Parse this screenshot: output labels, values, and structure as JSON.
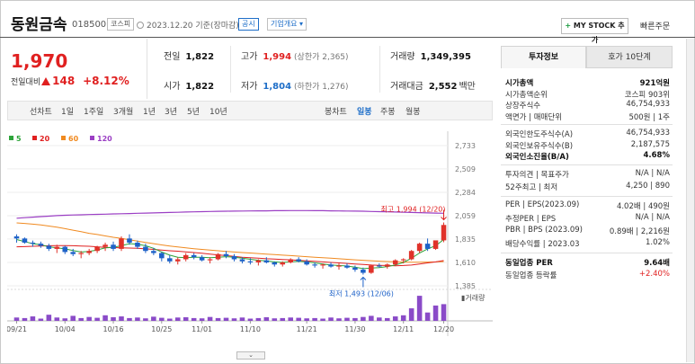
{
  "header": {
    "name": "동원금속",
    "code": "018500",
    "market": "코스피",
    "date": "2023.12.20 기준(장마감)",
    "disclosure": "공시",
    "company_info": "기업개요",
    "mystock": "MY STOCK 추가",
    "quick_order": "빠른주문"
  },
  "price": {
    "current": "1,970",
    "diff_label": "전일대비",
    "diff": "148",
    "pct": "+8.12%"
  },
  "stats": {
    "prev_label": "전일",
    "prev": "1,822",
    "high_label": "고가",
    "high": "1,994",
    "high_limit": "(상한가 2,365)",
    "volume_label": "거래량",
    "volume": "1,349,395",
    "open_label": "시가",
    "open": "1,822",
    "low_label": "저가",
    "low": "1,804",
    "low_limit": "(하한가 1,276)",
    "amount_label": "거래대금",
    "amount": "2,552",
    "amount_unit": "백만"
  },
  "tabs": {
    "left": [
      "선차트",
      "1일",
      "1주일",
      "3개월",
      "1년",
      "3년",
      "5년",
      "10년"
    ],
    "right": [
      "봉차트",
      "일봉",
      "주봉",
      "월봉"
    ]
  },
  "legend": [
    {
      "label": "5",
      "color": "#2da43a"
    },
    {
      "label": "20",
      "color": "#e02020"
    },
    {
      "label": "60",
      "color": "#f08a20"
    },
    {
      "label": "120",
      "color": "#9b3fc4"
    }
  ],
  "chart_data": {
    "type": "candlestick",
    "y_ticks": [
      "2,733",
      "2,509",
      "2,284",
      "2,059",
      "1,835",
      "1,610",
      "1,385"
    ],
    "ylim": [
      1385,
      2733
    ],
    "x_ticks": [
      "09/21",
      "10/04",
      "10/16",
      "10/25",
      "11/01",
      "11/10",
      "11/21",
      "11/30",
      "12/11",
      "12/20"
    ],
    "volume_label": "거래량",
    "max_annotation": "최고 1,994 (12/20)",
    "min_annotation": "최저 1,493 (12/06)",
    "candles": [
      [
        1860,
        1880,
        1800,
        1840
      ],
      [
        1840,
        1850,
        1790,
        1800
      ],
      [
        1800,
        1820,
        1760,
        1790
      ],
      [
        1790,
        1810,
        1750,
        1770
      ],
      [
        1770,
        1790,
        1720,
        1740
      ],
      [
        1740,
        1780,
        1700,
        1760
      ],
      [
        1760,
        1770,
        1690,
        1710
      ],
      [
        1710,
        1740,
        1670,
        1690
      ],
      [
        1690,
        1720,
        1650,
        1700
      ],
      [
        1700,
        1740,
        1680,
        1720
      ],
      [
        1720,
        1770,
        1700,
        1760
      ],
      [
        1760,
        1800,
        1720,
        1780
      ],
      [
        1780,
        1810,
        1720,
        1740
      ],
      [
        1740,
        1860,
        1720,
        1840
      ],
      [
        1840,
        1880,
        1780,
        1800
      ],
      [
        1800,
        1820,
        1740,
        1760
      ],
      [
        1760,
        1790,
        1700,
        1720
      ],
      [
        1720,
        1750,
        1680,
        1700
      ],
      [
        1700,
        1710,
        1620,
        1650
      ],
      [
        1650,
        1680,
        1600,
        1620
      ],
      [
        1620,
        1660,
        1590,
        1640
      ],
      [
        1640,
        1700,
        1620,
        1680
      ],
      [
        1680,
        1700,
        1640,
        1660
      ],
      [
        1660,
        1680,
        1620,
        1630
      ],
      [
        1630,
        1660,
        1600,
        1640
      ],
      [
        1640,
        1700,
        1630,
        1690
      ],
      [
        1690,
        1720,
        1650,
        1670
      ],
      [
        1670,
        1690,
        1620,
        1640
      ],
      [
        1640,
        1660,
        1600,
        1620
      ],
      [
        1620,
        1650,
        1590,
        1610
      ],
      [
        1610,
        1640,
        1580,
        1630
      ],
      [
        1630,
        1660,
        1600,
        1610
      ],
      [
        1610,
        1620,
        1570,
        1590
      ],
      [
        1590,
        1620,
        1570,
        1610
      ],
      [
        1610,
        1650,
        1600,
        1640
      ],
      [
        1640,
        1660,
        1610,
        1620
      ],
      [
        1620,
        1640,
        1580,
        1590
      ],
      [
        1590,
        1610,
        1560,
        1580
      ],
      [
        1580,
        1600,
        1550,
        1590
      ],
      [
        1590,
        1610,
        1560,
        1570
      ],
      [
        1570,
        1600,
        1540,
        1580
      ],
      [
        1580,
        1600,
        1550,
        1560
      ],
      [
        1560,
        1580,
        1520,
        1540
      ],
      [
        1540,
        1560,
        1493,
        1510
      ],
      [
        1510,
        1590,
        1500,
        1580
      ],
      [
        1580,
        1600,
        1560,
        1570
      ],
      [
        1570,
        1600,
        1550,
        1590
      ],
      [
        1590,
        1640,
        1580,
        1630
      ],
      [
        1630,
        1650,
        1600,
        1640
      ],
      [
        1640,
        1730,
        1630,
        1720
      ],
      [
        1720,
        1800,
        1700,
        1790
      ],
      [
        1790,
        1840,
        1720,
        1740
      ],
      [
        1740,
        1820,
        1730,
        1822
      ],
      [
        1822,
        1994,
        1804,
        1970
      ]
    ],
    "volumes": [
      0.12,
      0.1,
      0.16,
      0.08,
      0.22,
      0.12,
      0.09,
      0.18,
      0.1,
      0.14,
      0.11,
      0.2,
      0.13,
      0.16,
      0.1,
      0.12,
      0.09,
      0.15,
      0.11,
      0.08,
      0.12,
      0.13,
      0.1,
      0.09,
      0.14,
      0.1,
      0.11,
      0.09,
      0.12,
      0.08,
      0.1,
      0.13,
      0.09,
      0.1,
      0.12,
      0.11,
      0.09,
      0.1,
      0.08,
      0.12,
      0.09,
      0.11,
      0.1,
      0.14,
      0.18,
      0.12,
      0.1,
      0.16,
      0.2,
      0.45,
      0.9,
      0.3,
      0.55,
      0.6
    ],
    "ma": {
      "ma5": [
        1830,
        1810,
        1790,
        1780,
        1760,
        1750,
        1740,
        1725,
        1710,
        1715,
        1730,
        1750,
        1755,
        1770,
        1790,
        1785,
        1770,
        1745,
        1710,
        1680,
        1660,
        1655,
        1660,
        1660,
        1655,
        1660,
        1665,
        1660,
        1650,
        1640,
        1630,
        1625,
        1615,
        1610,
        1615,
        1620,
        1615,
        1605,
        1595,
        1585,
        1580,
        1575,
        1565,
        1550,
        1555,
        1560,
        1570,
        1585,
        1610,
        1650,
        1700,
        1740,
        1770,
        1830
      ],
      "ma20": [
        1760,
        1762,
        1765,
        1768,
        1770,
        1772,
        1772,
        1770,
        1768,
        1765,
        1760,
        1755,
        1752,
        1750,
        1748,
        1745,
        1740,
        1735,
        1728,
        1722,
        1718,
        1712,
        1705,
        1698,
        1690,
        1682,
        1675,
        1668,
        1660,
        1655,
        1650,
        1645,
        1642,
        1638,
        1635,
        1630,
        1625,
        1620,
        1615,
        1610,
        1605,
        1600,
        1595,
        1590,
        1585,
        1582,
        1580,
        1578,
        1580,
        1585,
        1595,
        1605,
        1615,
        1628
      ],
      "ma60": [
        1990,
        1985,
        1978,
        1970,
        1960,
        1948,
        1935,
        1920,
        1905,
        1890,
        1878,
        1865,
        1852,
        1840,
        1828,
        1815,
        1802,
        1790,
        1778,
        1768,
        1758,
        1750,
        1742,
        1735,
        1728,
        1722,
        1716,
        1710,
        1705,
        1700,
        1695,
        1690,
        1685,
        1680,
        1675,
        1670,
        1665,
        1660,
        1655,
        1650,
        1645,
        1640,
        1635,
        1630,
        1626,
        1622,
        1618,
        1615,
        1613,
        1612,
        1612,
        1613,
        1615,
        1618
      ],
      "ma120": [
        2035,
        2040,
        2045,
        2050,
        2055,
        2060,
        2063,
        2066,
        2068,
        2070,
        2072,
        2074,
        2076,
        2078,
        2080,
        2082,
        2084,
        2086,
        2088,
        2090,
        2092,
        2094,
        2096,
        2098,
        2100,
        2101,
        2102,
        2103,
        2104,
        2105,
        2106,
        2106,
        2107,
        2107,
        2108,
        2108,
        2108,
        2107,
        2107,
        2106,
        2105,
        2104,
        2103,
        2102,
        2100,
        2098,
        2096,
        2094,
        2092,
        2090,
        2088,
        2086,
        2084,
        2082
      ]
    }
  },
  "right_panel": {
    "tab_invest": "투자정보",
    "tab_quote": "호가 10단계",
    "rows1": [
      {
        "label": "시가총액",
        "value": "921억원",
        "bold": true
      },
      {
        "label": "시가총액순위",
        "value": "코스피 903위",
        "bold": false
      },
      {
        "label": "상장주식수",
        "value": "46,754,933",
        "bold": false
      },
      {
        "label": "액면가 | 매매단위",
        "value": "500원 | 1주",
        "bold": false
      }
    ],
    "rows2": [
      {
        "label": "외국인한도주식수(A)",
        "value": "46,754,933",
        "bold": false
      },
      {
        "label": "외국인보유주식수(B)",
        "value": "2,187,575",
        "bold": false
      },
      {
        "label": "외국인소진율(B/A)",
        "value": "4.68%",
        "bold": true
      }
    ],
    "rows3": [
      {
        "label": "투자의견 | 목표주가",
        "value": "N/A | N/A",
        "bold": false
      },
      {
        "label": "52주최고 | 최저",
        "value": "4,250 | 890",
        "bold": false
      }
    ],
    "rows4": [
      {
        "label": "PER | EPS(2023.09)",
        "value": "4.02배 | 490원",
        "bold": false
      },
      {
        "label": "추정PER | EPS",
        "value": "N/A | N/A",
        "bold": false
      },
      {
        "label": "PBR | BPS (2023.09)",
        "value": "0.89배 | 2,216원",
        "bold": false
      },
      {
        "label": "배당수익률 | 2023.03",
        "value": "1.02%",
        "bold": false
      }
    ],
    "rows5": [
      {
        "label": "동일업종 PER",
        "value": "9.64배",
        "bold": true
      },
      {
        "label": "동일업종 등락률",
        "value": "+2.40%",
        "bold": false,
        "red": true
      }
    ]
  }
}
